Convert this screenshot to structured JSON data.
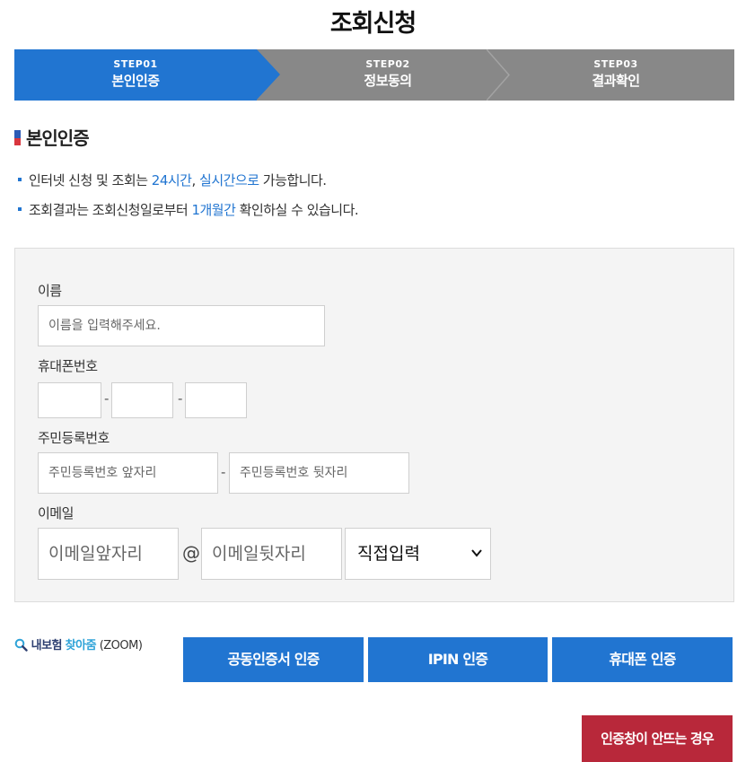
{
  "page": {
    "title": "조회신청"
  },
  "steps": [
    {
      "num": "STEP01",
      "name": "본인인증"
    },
    {
      "num": "STEP02",
      "name": "정보동의"
    },
    {
      "num": "STEP03",
      "name": "결과확인"
    }
  ],
  "section": {
    "title": "본인인증"
  },
  "notices": [
    {
      "pre": "인터넷 신청 및 조회는 ",
      "hl1": "24시간",
      "mid": ", ",
      "hl2": "실시간으로",
      "post": " 가능합니다."
    },
    {
      "pre": "조회결과는 조회신청일로부터 ",
      "hl1": "1개월간",
      "post": " 확인하실 수 있습니다."
    }
  ],
  "form": {
    "name_label": "이름",
    "name_placeholder": "이름을 입력해주세요.",
    "phone_label": "휴대폰번호",
    "phone_sep": "-",
    "rrn_label": "주민등록번호",
    "rrn_front_placeholder": "주민등록번호 앞자리",
    "rrn_back_placeholder": "주민등록번호 뒷자리",
    "rrn_sep": "-",
    "email_label": "이메일",
    "email_front_placeholder": "이메일앞자리",
    "email_at": "@",
    "email_back_placeholder": "이메일뒷자리",
    "email_domain_selected": "직접입력"
  },
  "zoom": {
    "insurance": "내보험",
    "find": "찾아줌",
    "suffix": "(ZOOM)"
  },
  "buttons": {
    "cert": "공동인증서 인증",
    "ipin": "IPIN 인증",
    "phone": "휴대폰 인증",
    "help": "인증창이 안뜨는 경우"
  },
  "colors": {
    "accent": "#2175d1",
    "step_inactive": "#888888",
    "help_button": "#b8283a"
  }
}
